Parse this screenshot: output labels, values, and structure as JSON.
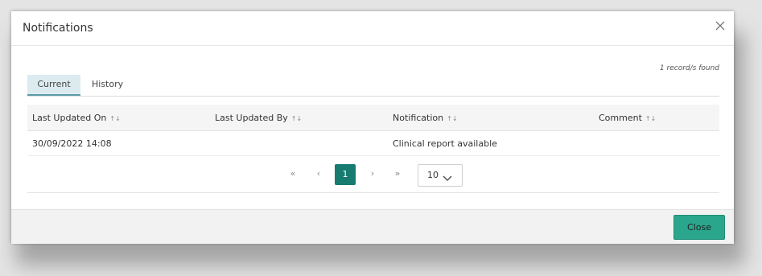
{
  "dialog": {
    "title": "Notifications",
    "close_icon": "close-icon"
  },
  "record_count": "1 record/s found",
  "tabs": [
    {
      "label": "Current",
      "active": true
    },
    {
      "label": "History",
      "active": false
    }
  ],
  "table": {
    "sort_icon": "sort-icon",
    "columns": [
      {
        "label": "Last Updated On"
      },
      {
        "label": "Last Updated By"
      },
      {
        "label": "Notification"
      },
      {
        "label": "Comment"
      }
    ],
    "rows": [
      {
        "last_updated_on": "30/09/2022 14:08",
        "last_updated_by": "",
        "notification": "Clinical report available",
        "comment": ""
      }
    ]
  },
  "paginator": {
    "first": "«",
    "prev": "‹",
    "current_page": "1",
    "next": "›",
    "last": "»",
    "page_size": "10",
    "dropdown_icon": "chevron-down-icon"
  },
  "footer": {
    "close_label": "Close"
  },
  "colors": {
    "accent": "#177b72",
    "button": "#2aa68d",
    "tab_active_bg": "#dcebf0"
  }
}
